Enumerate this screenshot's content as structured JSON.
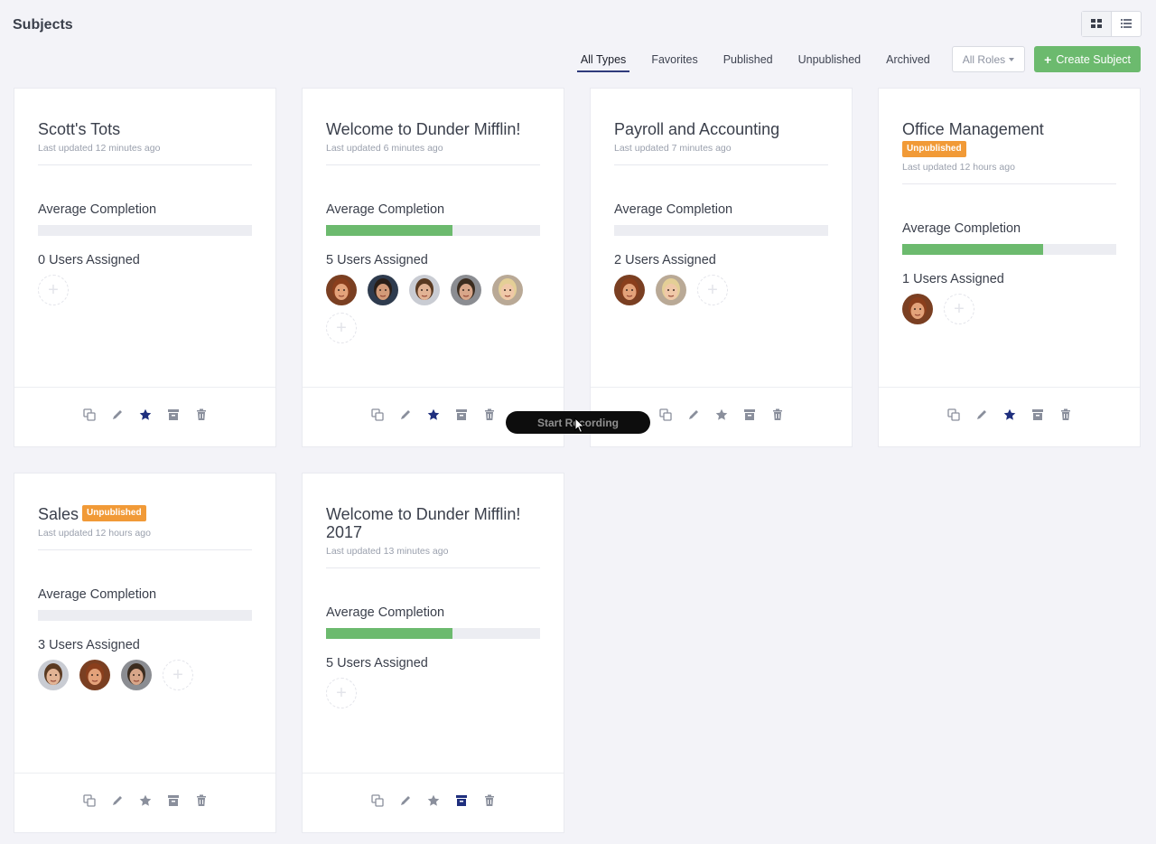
{
  "page": {
    "title": "Subjects"
  },
  "filters": {
    "tabs": [
      {
        "label": "All Types",
        "active": true
      },
      {
        "label": "Favorites"
      },
      {
        "label": "Published"
      },
      {
        "label": "Unpublished"
      },
      {
        "label": "Archived"
      }
    ],
    "roles_label": "All Roles",
    "create_label": "Create Subject"
  },
  "cards": [
    {
      "title": "Scott's Tots",
      "updated": "Last updated 12 minutes ago",
      "avg_label": "Average Completion",
      "completion": 0,
      "users_label": "0 Users Assigned",
      "avatars": [],
      "favorite": true,
      "archived": false
    },
    {
      "title": "Welcome to Dunder Mifflin!",
      "updated": "Last updated 6 minutes ago",
      "avg_label": "Average Completion",
      "completion": 0.59,
      "users_label": "5 Users Assigned",
      "avatars": [
        "pam",
        "michael",
        "jim",
        "dwight",
        "angela"
      ],
      "favorite": true,
      "archived": false
    },
    {
      "title": "Payroll and Accounting",
      "updated": "Last updated 7 minutes ago",
      "avg_label": "Average Completion",
      "completion": 0,
      "users_label": "2 Users Assigned",
      "avatars": [
        "pam",
        "angela"
      ],
      "favorite": false,
      "archived": false
    },
    {
      "title": "Office Management",
      "badge": "Unpublished",
      "updated": "Last updated 12 hours ago",
      "avg_label": "Average Completion",
      "completion": 0.66,
      "users_label": "1 Users Assigned",
      "avatars": [
        "pam"
      ],
      "favorite": true,
      "archived": false
    },
    {
      "title": "Sales",
      "badge": "Unpublished",
      "badge_inline": true,
      "updated": "Last updated 12 hours ago",
      "avg_label": "Average Completion",
      "completion": 0,
      "users_label": "3 Users Assigned",
      "avatars": [
        "jim",
        "pam",
        "dwight"
      ],
      "favorite": false,
      "archived": false
    },
    {
      "title": "Welcome to Dunder Mifflin! 2017",
      "updated": "Last updated 13 minutes ago",
      "avg_label": "Average Completion",
      "completion": 0.59,
      "users_label": "5 Users Assigned",
      "avatars": [],
      "favorite": false,
      "archived": true
    }
  ],
  "recording": {
    "label": "Start Recording"
  },
  "colors": {
    "accent_navy": "#1f2f7e",
    "success": "#6cba6e",
    "badge": "#f19a37",
    "icon_gray": "#8a8f9c"
  },
  "icons": [
    "grid-view-icon",
    "list-view-icon",
    "plus-icon",
    "duplicate-icon",
    "pencil-icon",
    "star-icon",
    "archive-icon",
    "trash-icon",
    "cursor-icon"
  ]
}
